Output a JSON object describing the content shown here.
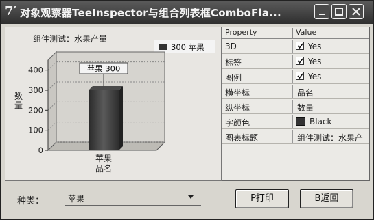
{
  "window": {
    "title": "对象观察器TeeInspector与组合列表框ComboFla..."
  },
  "chart_data": {
    "type": "bar",
    "title": "组件测试：水果产量",
    "categories": [
      "苹果"
    ],
    "xlabel": "品名",
    "ylabel": "数量",
    "series": [
      {
        "name": "苹果",
        "values": [
          300
        ]
      }
    ],
    "ylim": [
      0,
      450
    ],
    "yticks": [
      0,
      100,
      200,
      300,
      400
    ],
    "data_labels": [
      "苹果 300"
    ],
    "legend": {
      "text": "300 苹果",
      "placement": "top-right"
    },
    "bar_color": "#3c3c3c",
    "three_d": true
  },
  "inspector": {
    "headers": {
      "property": "Property",
      "value": "Value"
    },
    "rows": [
      {
        "property": "3D",
        "value": "Yes",
        "kind": "checkbox"
      },
      {
        "property": "标签",
        "value": "Yes",
        "kind": "checkbox"
      },
      {
        "property": "图例",
        "value": "Yes",
        "kind": "checkbox"
      },
      {
        "property": "横坐标",
        "value": "品名",
        "kind": "text"
      },
      {
        "property": "纵坐标",
        "value": "数量",
        "kind": "text"
      },
      {
        "property": "字颜色",
        "value": "Black",
        "kind": "color",
        "color": "#333333"
      },
      {
        "property": "图表标题",
        "value": "组件测试：水果产",
        "kind": "text"
      }
    ]
  },
  "bottom": {
    "kind_label": "种类：",
    "kind_value": "苹果",
    "print_button": "P打印",
    "back_button": "B返回"
  }
}
